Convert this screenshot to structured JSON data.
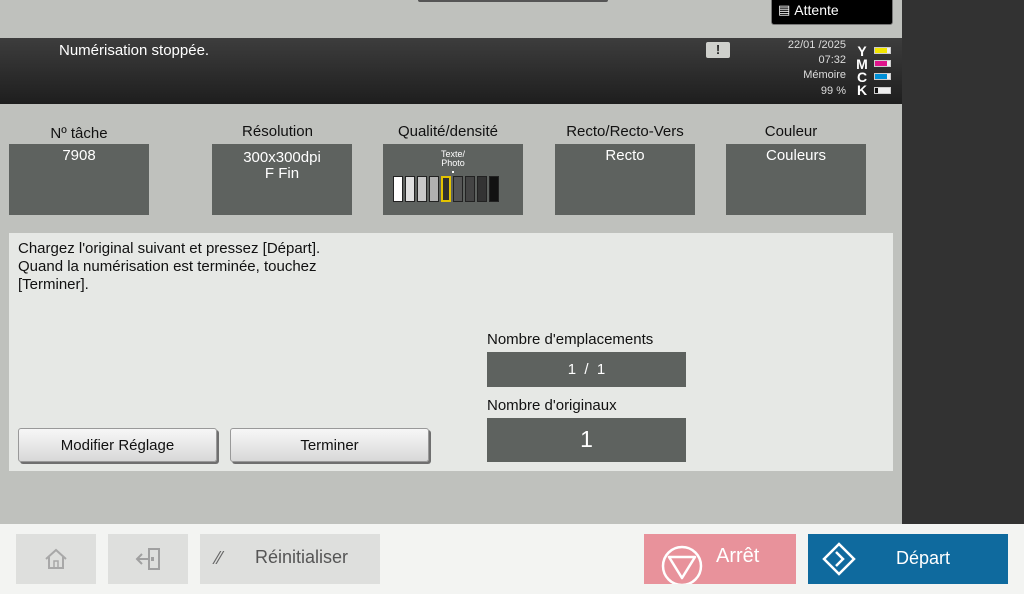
{
  "header": {
    "attente_label": "Attente",
    "status_message": "Numérisation stoppée.",
    "date": "22/01 /2025",
    "time": "07:32",
    "memory_label": "Mémoire",
    "memory_value": "99 %",
    "toner": [
      {
        "letter": "Y",
        "color": "#f2e600",
        "level": 0.8
      },
      {
        "letter": "M",
        "color": "#e0148c",
        "level": 0.8
      },
      {
        "letter": "C",
        "color": "#0090d8",
        "level": 0.8
      },
      {
        "letter": "K",
        "color": "#111111",
        "level": 0.2
      }
    ]
  },
  "settings": {
    "job_label": "Nº tâche",
    "job_value": "7908",
    "resolution_label": "Résolution",
    "resolution_value_1": "300x300dpi",
    "resolution_value_2": "F Fin",
    "quality_label": "Qualité/densité",
    "quality_mode_line1": "Texte/",
    "quality_mode_line2": "Photo",
    "density_level": 5,
    "density_steps": 9,
    "duplex_label": "Recto/Recto-Vers",
    "duplex_value": "Recto",
    "color_label": "Couleur",
    "color_value": "Couleurs"
  },
  "main": {
    "instructions": "Chargez l'original suivant et pressez [Départ].\nQuand la numérisation est terminée, touchez\n[Terminer].",
    "locations_label": "Nombre d'emplacements",
    "locations_value": "1  /  1",
    "originals_label": "Nombre d'originaux",
    "originals_value": "1",
    "modify_button": "Modifier Réglage",
    "finish_button": "Terminer"
  },
  "footer": {
    "home_icon": "home-icon",
    "logout_icon": "logout-icon",
    "reset_label": "Réinitialiser",
    "stop_label": "Arrêt",
    "start_label": "Départ",
    "stop_color": "#e8929b",
    "start_color": "#0f6a9e"
  }
}
